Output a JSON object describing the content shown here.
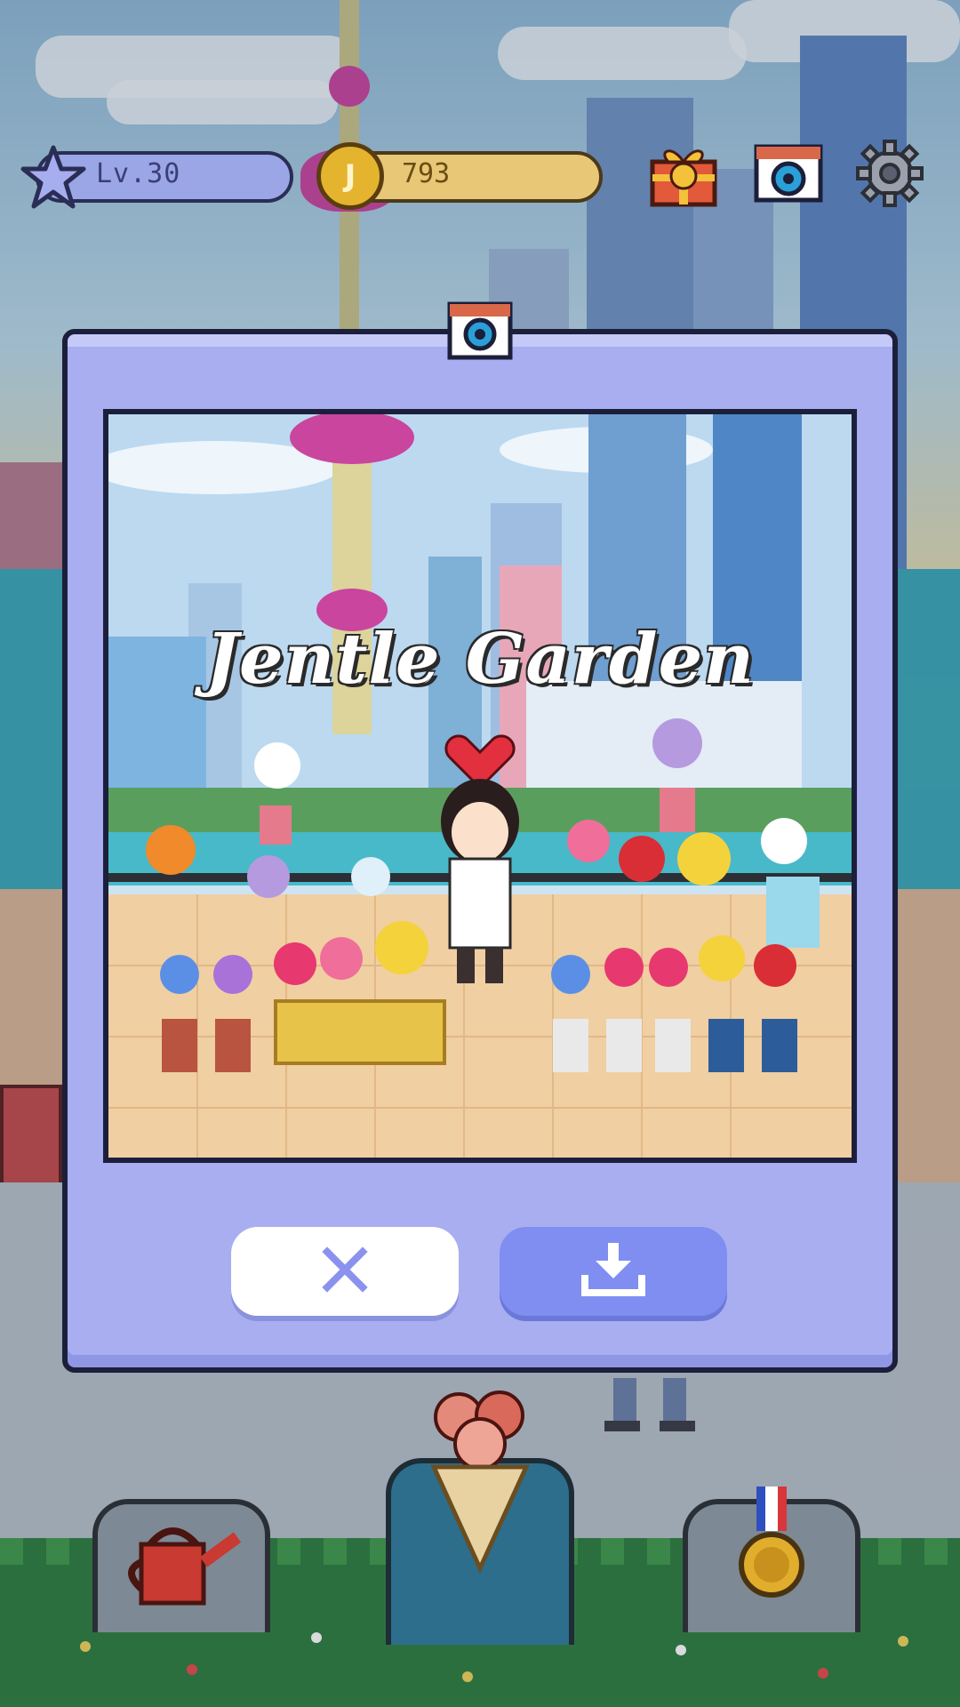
{
  "hud": {
    "level_label": "Lv.30",
    "coin_symbol": "J",
    "coin_count": "793",
    "gift_icon": "gift-box-icon",
    "camera_icon": "camera-icon",
    "settings_icon": "gear-icon"
  },
  "dialog": {
    "camera_icon": "camera-icon",
    "photo_title": "Jentle Garden",
    "close_icon": "close-x-icon",
    "download_icon": "download-icon"
  },
  "dock": {
    "left_icon": "watering-can-icon",
    "center_icon": "flower-bouquet-icon",
    "right_icon": "medal-icon"
  },
  "colors": {
    "dialog_bg": "#a8aef0",
    "accent_button": "#7f8ef0",
    "level_pill": "#9aa6e6",
    "coin_pill": "#e8c777"
  }
}
